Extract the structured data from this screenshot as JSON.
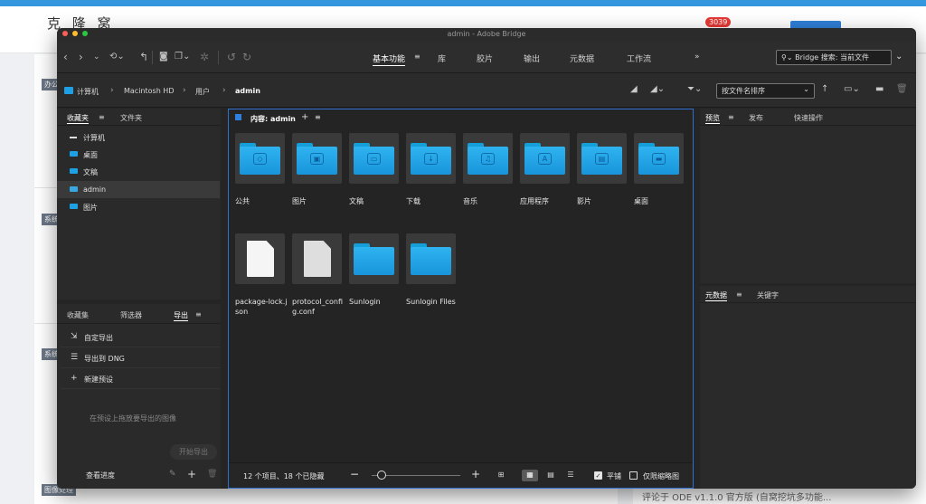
{
  "background_site": {
    "logo": "克 隆 窝",
    "notification_count": "3039",
    "tags": [
      "办公",
      "系统",
      "系统",
      "图像处理"
    ],
    "footer_text": "评论于 ODE v1.1.0 官方版 (自窝挖坑多功能..."
  },
  "window": {
    "title": "admin - Adobe Bridge"
  },
  "toolbar": {
    "workspaces": [
      "基本功能",
      "库",
      "胶片",
      "输出",
      "元数据",
      "工作流"
    ],
    "active_workspace": "基本功能",
    "more": "»",
    "search_placeholder": "Bridge 搜索: 当前文件"
  },
  "pathbar": {
    "crumbs": [
      "计算机",
      "Macintosh HD",
      "用户",
      "admin"
    ],
    "sort_label": "按文件名排序"
  },
  "left_top_panel": {
    "tabs": [
      "收藏夹",
      "文件夹"
    ],
    "items": [
      {
        "label": "计算机",
        "icon": "computer-icon"
      },
      {
        "label": "桌面",
        "icon": "folder-icon"
      },
      {
        "label": "文稿",
        "icon": "folder-icon"
      },
      {
        "label": "admin",
        "icon": "home-folder-icon",
        "selected": true
      },
      {
        "label": "图片",
        "icon": "folder-icon"
      }
    ]
  },
  "left_bottom_panel": {
    "tabs": [
      "收藏集",
      "筛选器",
      "导出"
    ],
    "active_tab": "导出",
    "items": [
      {
        "label": "自定导出",
        "icon": "export-icon"
      },
      {
        "label": "导出到 DNG",
        "icon": "list-icon"
      },
      {
        "label": "新建预设",
        "icon": "plus-icon"
      }
    ],
    "drop_hint": "在预设上拖放要导出的图像",
    "start_export": "开始导出",
    "progress_label": "查看进度"
  },
  "content": {
    "title": "内容: admin",
    "items": [
      {
        "label": "公共",
        "kind": "folder",
        "glyph": "◇"
      },
      {
        "label": "图片",
        "kind": "folder",
        "glyph": "▣"
      },
      {
        "label": "文稿",
        "kind": "folder",
        "glyph": "▭"
      },
      {
        "label": "下载",
        "kind": "folder",
        "glyph": "↓"
      },
      {
        "label": "音乐",
        "kind": "folder",
        "glyph": "♫"
      },
      {
        "label": "应用程序",
        "kind": "folder",
        "glyph": "A"
      },
      {
        "label": "影片",
        "kind": "folder",
        "glyph": "▤"
      },
      {
        "label": "桌面",
        "kind": "folder",
        "glyph": "▬"
      },
      {
        "label": "package-lock.json",
        "kind": "doc"
      },
      {
        "label": "protocol_config.conf",
        "kind": "doc-gray"
      },
      {
        "label": "Sunlogin",
        "kind": "folder",
        "glyph": ""
      },
      {
        "label": "Sunlogin Files",
        "kind": "folder",
        "glyph": ""
      }
    ],
    "status_text": "12 个项目、18 个已隐藏",
    "tile_label": "平铺",
    "thumbs_only_label": "仅限缩略图",
    "tile_checked": true,
    "thumbs_only_checked": false
  },
  "right_top_panel": {
    "tabs": [
      "预览",
      "发布",
      "快速操作"
    ]
  },
  "right_bottom_panel": {
    "tabs": [
      "元数据",
      "关键字"
    ]
  }
}
